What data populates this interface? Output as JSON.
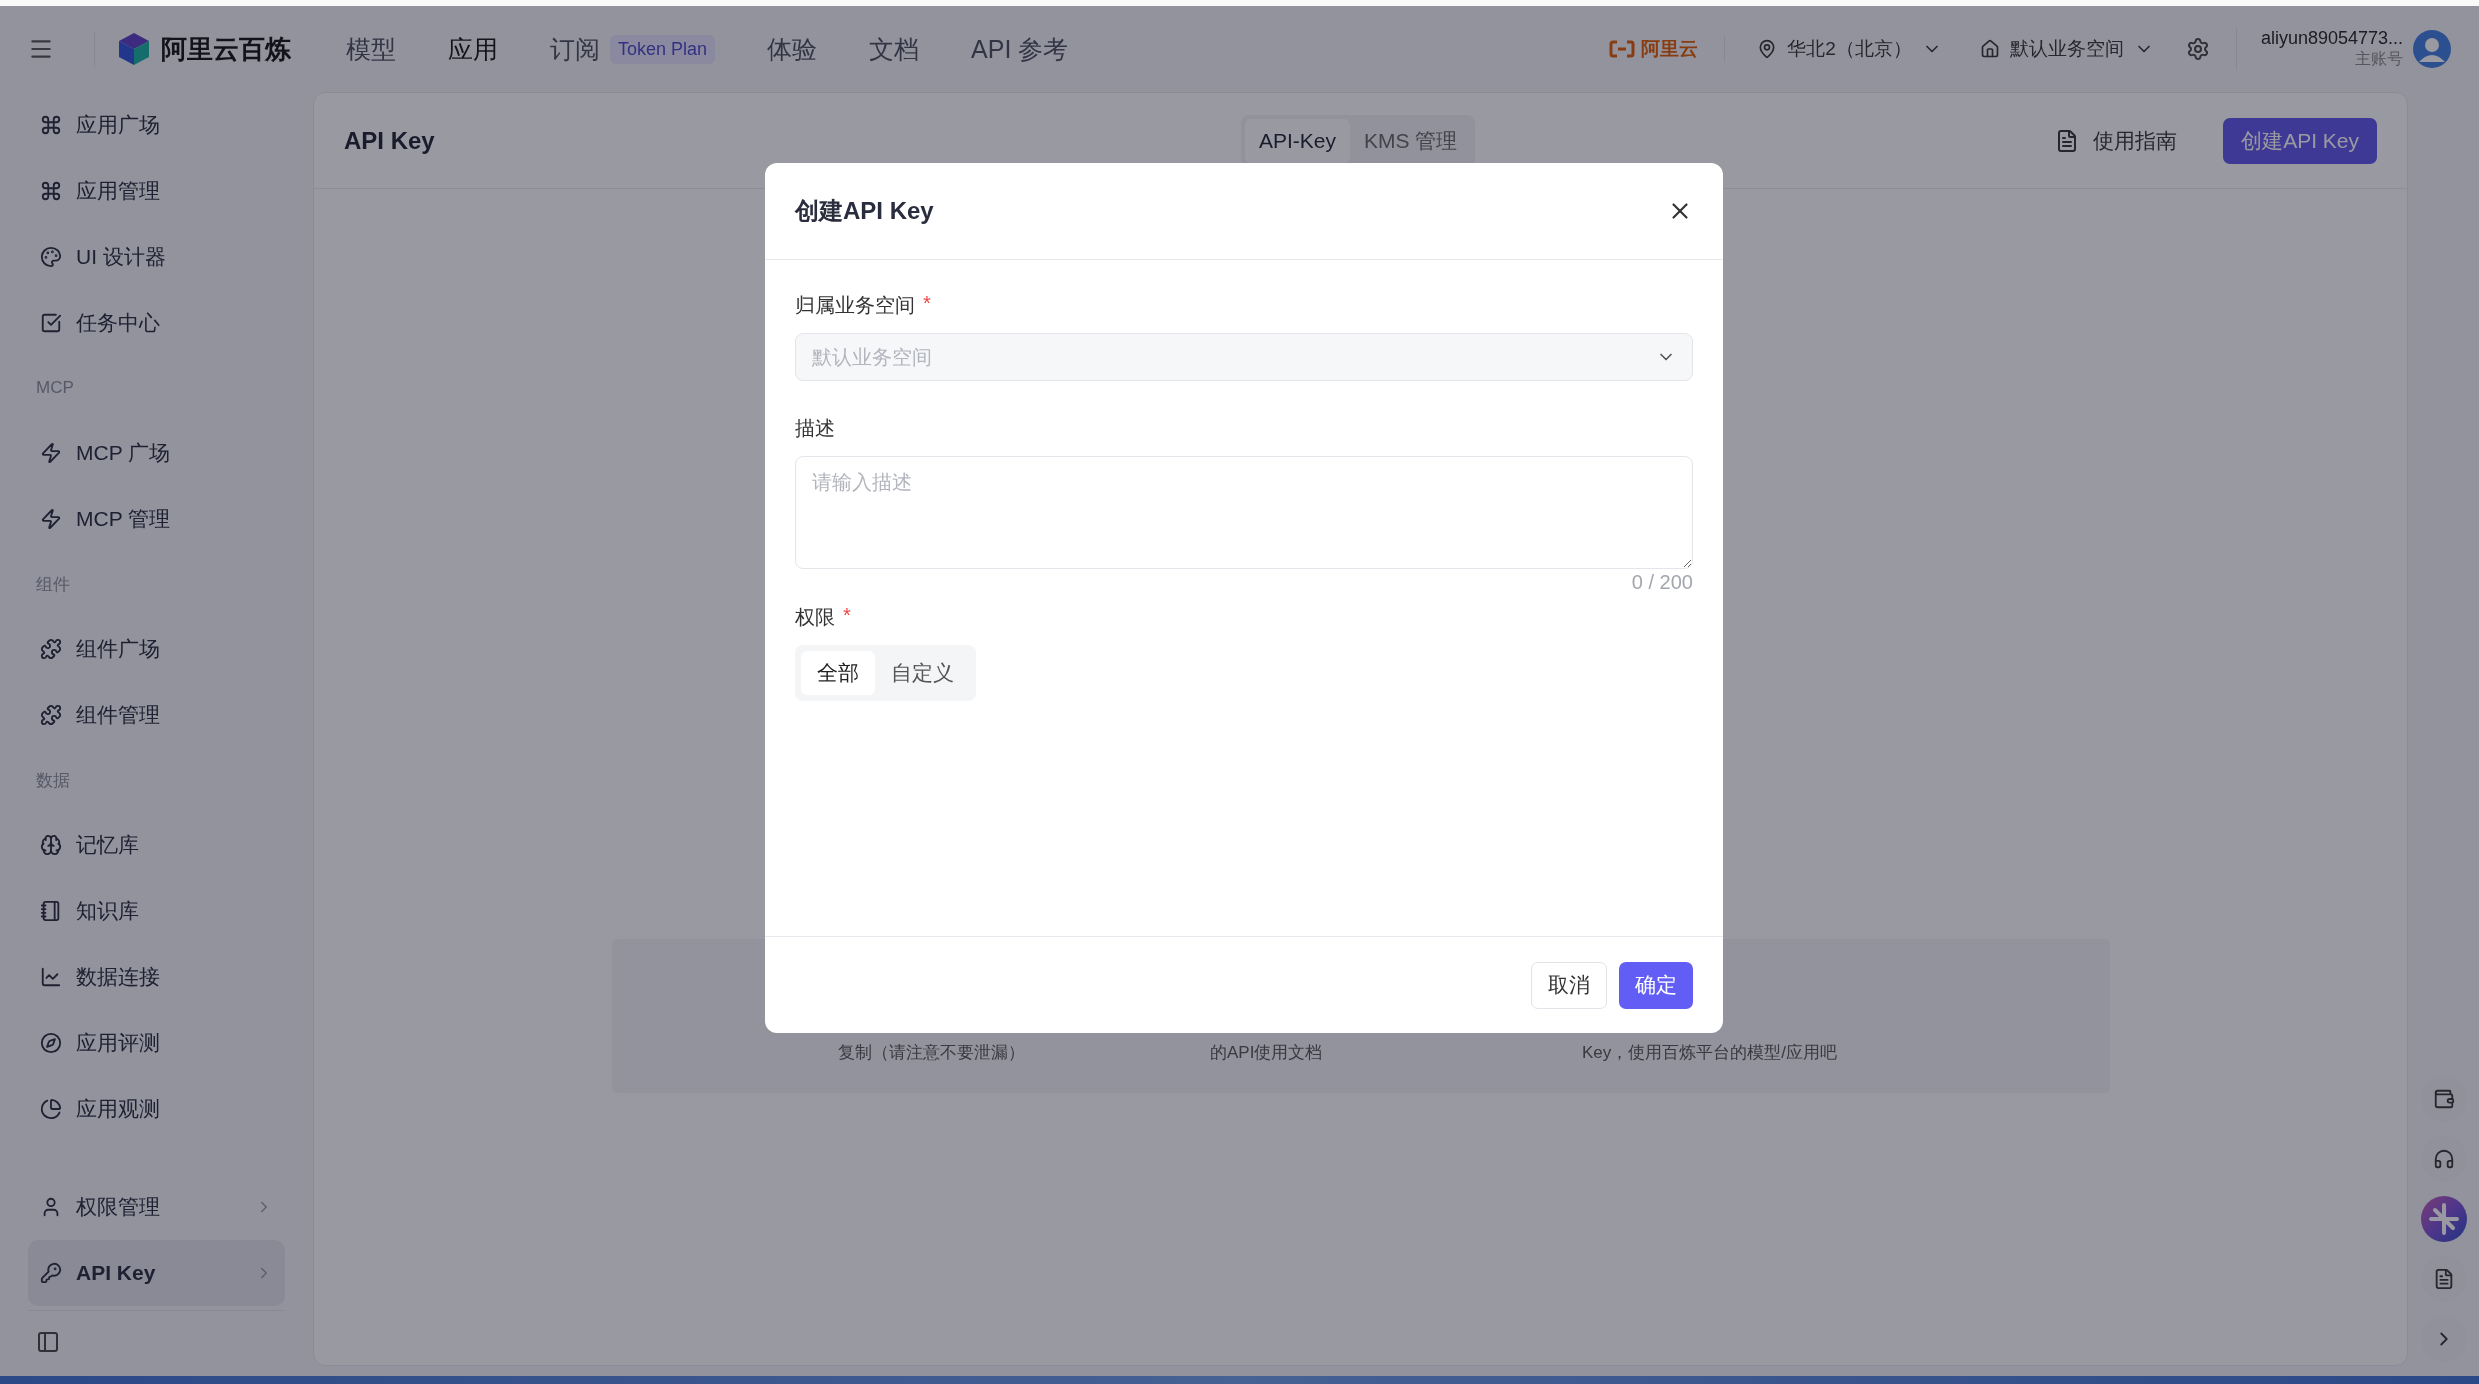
{
  "topbar": {
    "brand": "阿里云百炼",
    "nav": [
      {
        "label": "模型",
        "selected": false
      },
      {
        "label": "应用",
        "selected": true
      },
      {
        "label": "订阅",
        "selected": false,
        "badge": "Token Plan"
      },
      {
        "label": "体验",
        "selected": false
      },
      {
        "label": "文档",
        "selected": false
      },
      {
        "label": "API 参考",
        "selected": false
      }
    ],
    "cloud_brand": "阿里云",
    "region": "华北2（北京）",
    "workspace": "默认业务空间",
    "account": "aliyun89054773...",
    "account_role": "主账号"
  },
  "sidebar": {
    "items": [
      {
        "kind": "item",
        "label": "应用广场",
        "selected": false
      },
      {
        "kind": "item",
        "label": "应用管理",
        "selected": false
      },
      {
        "kind": "item",
        "label": "UI 设计器",
        "selected": false
      },
      {
        "kind": "item",
        "label": "任务中心",
        "selected": false
      },
      {
        "kind": "section",
        "label": "MCP"
      },
      {
        "kind": "item",
        "label": "MCP 广场",
        "selected": false
      },
      {
        "kind": "item",
        "label": "MCP 管理",
        "selected": false
      },
      {
        "kind": "section",
        "label": "组件"
      },
      {
        "kind": "item",
        "label": "组件广场",
        "selected": false
      },
      {
        "kind": "item",
        "label": "组件管理",
        "selected": false
      },
      {
        "kind": "section",
        "label": "数据"
      },
      {
        "kind": "item",
        "label": "记忆库",
        "selected": false
      },
      {
        "kind": "item",
        "label": "知识库",
        "selected": false
      },
      {
        "kind": "item",
        "label": "数据连接",
        "selected": false
      },
      {
        "kind": "item",
        "label": "应用评测",
        "selected": false
      },
      {
        "kind": "item",
        "label": "应用观测",
        "selected": false
      },
      {
        "kind": "group",
        "label": "权限管理",
        "selected": false
      },
      {
        "kind": "group",
        "label": "API Key",
        "selected": true
      }
    ]
  },
  "main": {
    "title": "API Key",
    "tabs": [
      {
        "label": "API-Key",
        "selected": true
      },
      {
        "label": "KMS 管理",
        "selected": false
      }
    ],
    "guide_button": "使用指南",
    "create_button": "创建API Key",
    "cards": [
      {
        "text": "复制（请注意不要泄漏）"
      },
      {
        "text": "的API使用文档"
      },
      {
        "text": "Key，使用百炼平台的模型/应用吧"
      }
    ]
  },
  "modal": {
    "title": "创建API Key",
    "workspace_field": {
      "label": "归属业务空间",
      "required_mark": "*",
      "value": "默认业务空间",
      "disabled": true
    },
    "description_field": {
      "label": "描述",
      "placeholder": "请输入描述",
      "counter": "0 / 200"
    },
    "permission_field": {
      "label": "权限",
      "required_mark": "*",
      "options": [
        {
          "label": "全部",
          "selected": true
        },
        {
          "label": "自定义",
          "selected": false
        }
      ]
    },
    "buttons": [
      {
        "label": "取消",
        "kind": "secondary"
      },
      {
        "label": "确定",
        "kind": "primary"
      }
    ]
  }
}
